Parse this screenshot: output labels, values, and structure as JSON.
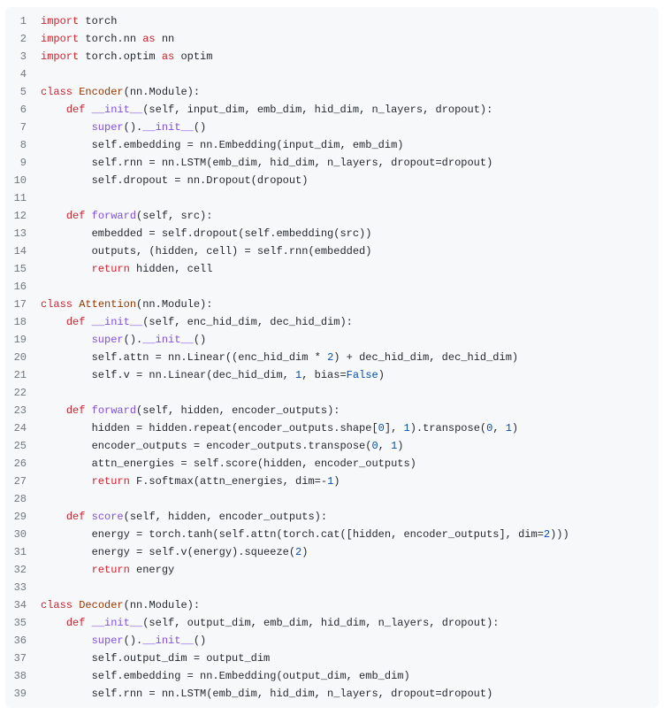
{
  "code": {
    "lines": [
      {
        "n": 1,
        "tokens": [
          {
            "t": "import ",
            "c": "kw"
          },
          {
            "t": "torch",
            "c": ""
          }
        ]
      },
      {
        "n": 2,
        "tokens": [
          {
            "t": "import ",
            "c": "kw"
          },
          {
            "t": "torch.nn ",
            "c": ""
          },
          {
            "t": "as ",
            "c": "kw"
          },
          {
            "t": "nn",
            "c": ""
          }
        ]
      },
      {
        "n": 3,
        "tokens": [
          {
            "t": "import ",
            "c": "kw"
          },
          {
            "t": "torch.optim ",
            "c": ""
          },
          {
            "t": "as ",
            "c": "kw"
          },
          {
            "t": "optim",
            "c": ""
          }
        ]
      },
      {
        "n": 4,
        "tokens": []
      },
      {
        "n": 5,
        "tokens": [
          {
            "t": "class ",
            "c": "kw"
          },
          {
            "t": "Encoder",
            "c": "cls"
          },
          {
            "t": "(nn.Module):",
            "c": ""
          }
        ]
      },
      {
        "n": 6,
        "tokens": [
          {
            "t": "    ",
            "c": ""
          },
          {
            "t": "def ",
            "c": "kw"
          },
          {
            "t": "__init__",
            "c": "fn"
          },
          {
            "t": "(self, input_dim, emb_dim, hid_dim, n_layers, dropout):",
            "c": ""
          }
        ]
      },
      {
        "n": 7,
        "tokens": [
          {
            "t": "        ",
            "c": ""
          },
          {
            "t": "super",
            "c": "fn"
          },
          {
            "t": "().",
            "c": ""
          },
          {
            "t": "__init__",
            "c": "fn"
          },
          {
            "t": "()",
            "c": ""
          }
        ]
      },
      {
        "n": 8,
        "tokens": [
          {
            "t": "        self.embedding = nn.Embedding(input_dim, emb_dim)",
            "c": ""
          }
        ]
      },
      {
        "n": 9,
        "tokens": [
          {
            "t": "        self.rnn = nn.LSTM(emb_dim, hid_dim, n_layers, dropout=dropout)",
            "c": ""
          }
        ]
      },
      {
        "n": 10,
        "tokens": [
          {
            "t": "        self.dropout = nn.Dropout(dropout)",
            "c": ""
          }
        ]
      },
      {
        "n": 11,
        "tokens": []
      },
      {
        "n": 12,
        "tokens": [
          {
            "t": "    ",
            "c": ""
          },
          {
            "t": "def ",
            "c": "kw"
          },
          {
            "t": "forward",
            "c": "fn"
          },
          {
            "t": "(self, src):",
            "c": ""
          }
        ]
      },
      {
        "n": 13,
        "tokens": [
          {
            "t": "        embedded = self.dropout(self.embedding(src))",
            "c": ""
          }
        ]
      },
      {
        "n": 14,
        "tokens": [
          {
            "t": "        outputs, (hidden, cell) = self.rnn(embedded)",
            "c": ""
          }
        ]
      },
      {
        "n": 15,
        "tokens": [
          {
            "t": "        ",
            "c": ""
          },
          {
            "t": "return ",
            "c": "kw"
          },
          {
            "t": "hidden, cell",
            "c": ""
          }
        ]
      },
      {
        "n": 16,
        "tokens": []
      },
      {
        "n": 17,
        "tokens": [
          {
            "t": "class ",
            "c": "kw"
          },
          {
            "t": "Attention",
            "c": "cls"
          },
          {
            "t": "(nn.Module):",
            "c": ""
          }
        ]
      },
      {
        "n": 18,
        "tokens": [
          {
            "t": "    ",
            "c": ""
          },
          {
            "t": "def ",
            "c": "kw"
          },
          {
            "t": "__init__",
            "c": "fn"
          },
          {
            "t": "(self, enc_hid_dim, dec_hid_dim):",
            "c": ""
          }
        ]
      },
      {
        "n": 19,
        "tokens": [
          {
            "t": "        ",
            "c": ""
          },
          {
            "t": "super",
            "c": "fn"
          },
          {
            "t": "().",
            "c": ""
          },
          {
            "t": "__init__",
            "c": "fn"
          },
          {
            "t": "()",
            "c": ""
          }
        ]
      },
      {
        "n": 20,
        "tokens": [
          {
            "t": "        self.attn = nn.Linear((enc_hid_dim * ",
            "c": ""
          },
          {
            "t": "2",
            "c": "num"
          },
          {
            "t": ") + dec_hid_dim, dec_hid_dim)",
            "c": ""
          }
        ]
      },
      {
        "n": 21,
        "tokens": [
          {
            "t": "        self.v = nn.Linear(dec_hid_dim, ",
            "c": ""
          },
          {
            "t": "1",
            "c": "num"
          },
          {
            "t": ", bias=",
            "c": ""
          },
          {
            "t": "False",
            "c": "const"
          },
          {
            "t": ")",
            "c": ""
          }
        ]
      },
      {
        "n": 22,
        "tokens": []
      },
      {
        "n": 23,
        "tokens": [
          {
            "t": "    ",
            "c": ""
          },
          {
            "t": "def ",
            "c": "kw"
          },
          {
            "t": "forward",
            "c": "fn"
          },
          {
            "t": "(self, hidden, encoder_outputs):",
            "c": ""
          }
        ]
      },
      {
        "n": 24,
        "tokens": [
          {
            "t": "        hidden = hidden.repeat(encoder_outputs.shape[",
            "c": ""
          },
          {
            "t": "0",
            "c": "num"
          },
          {
            "t": "], ",
            "c": ""
          },
          {
            "t": "1",
            "c": "num"
          },
          {
            "t": ").transpose(",
            "c": ""
          },
          {
            "t": "0",
            "c": "num"
          },
          {
            "t": ", ",
            "c": ""
          },
          {
            "t": "1",
            "c": "num"
          },
          {
            "t": ")",
            "c": ""
          }
        ]
      },
      {
        "n": 25,
        "tokens": [
          {
            "t": "        encoder_outputs = encoder_outputs.transpose(",
            "c": ""
          },
          {
            "t": "0",
            "c": "num"
          },
          {
            "t": ", ",
            "c": ""
          },
          {
            "t": "1",
            "c": "num"
          },
          {
            "t": ")",
            "c": ""
          }
        ]
      },
      {
        "n": 26,
        "tokens": [
          {
            "t": "        attn_energies = self.score(hidden, encoder_outputs)",
            "c": ""
          }
        ]
      },
      {
        "n": 27,
        "tokens": [
          {
            "t": "        ",
            "c": ""
          },
          {
            "t": "return ",
            "c": "kw"
          },
          {
            "t": "F.softmax(attn_energies, dim=-",
            "c": ""
          },
          {
            "t": "1",
            "c": "num"
          },
          {
            "t": ")",
            "c": ""
          }
        ]
      },
      {
        "n": 28,
        "tokens": []
      },
      {
        "n": 29,
        "tokens": [
          {
            "t": "    ",
            "c": ""
          },
          {
            "t": "def ",
            "c": "kw"
          },
          {
            "t": "score",
            "c": "fn"
          },
          {
            "t": "(self, hidden, encoder_outputs):",
            "c": ""
          }
        ]
      },
      {
        "n": 30,
        "tokens": [
          {
            "t": "        energy = torch.tanh(self.attn(torch.cat([hidden, encoder_outputs], dim=",
            "c": ""
          },
          {
            "t": "2",
            "c": "num"
          },
          {
            "t": ")))",
            "c": ""
          }
        ]
      },
      {
        "n": 31,
        "tokens": [
          {
            "t": "        energy = self.v(energy).squeeze(",
            "c": ""
          },
          {
            "t": "2",
            "c": "num"
          },
          {
            "t": ")",
            "c": ""
          }
        ]
      },
      {
        "n": 32,
        "tokens": [
          {
            "t": "        ",
            "c": ""
          },
          {
            "t": "return ",
            "c": "kw"
          },
          {
            "t": "energy",
            "c": ""
          }
        ]
      },
      {
        "n": 33,
        "tokens": []
      },
      {
        "n": 34,
        "tokens": [
          {
            "t": "class ",
            "c": "kw"
          },
          {
            "t": "Decoder",
            "c": "cls"
          },
          {
            "t": "(nn.Module):",
            "c": ""
          }
        ]
      },
      {
        "n": 35,
        "tokens": [
          {
            "t": "    ",
            "c": ""
          },
          {
            "t": "def ",
            "c": "kw"
          },
          {
            "t": "__init__",
            "c": "fn"
          },
          {
            "t": "(self, output_dim, emb_dim, hid_dim, n_layers, dropout):",
            "c": ""
          }
        ]
      },
      {
        "n": 36,
        "tokens": [
          {
            "t": "        ",
            "c": ""
          },
          {
            "t": "super",
            "c": "fn"
          },
          {
            "t": "().",
            "c": ""
          },
          {
            "t": "__init__",
            "c": "fn"
          },
          {
            "t": "()",
            "c": ""
          }
        ]
      },
      {
        "n": 37,
        "tokens": [
          {
            "t": "        self.output_dim = output_dim",
            "c": ""
          }
        ]
      },
      {
        "n": 38,
        "tokens": [
          {
            "t": "        self.embedding = nn.Embedding(output_dim, emb_dim)",
            "c": ""
          }
        ]
      },
      {
        "n": 39,
        "tokens": [
          {
            "t": "        self.rnn = nn.LSTM(emb_dim, hid_dim, n_layers, dropout=dropout)",
            "c": ""
          }
        ]
      }
    ]
  }
}
